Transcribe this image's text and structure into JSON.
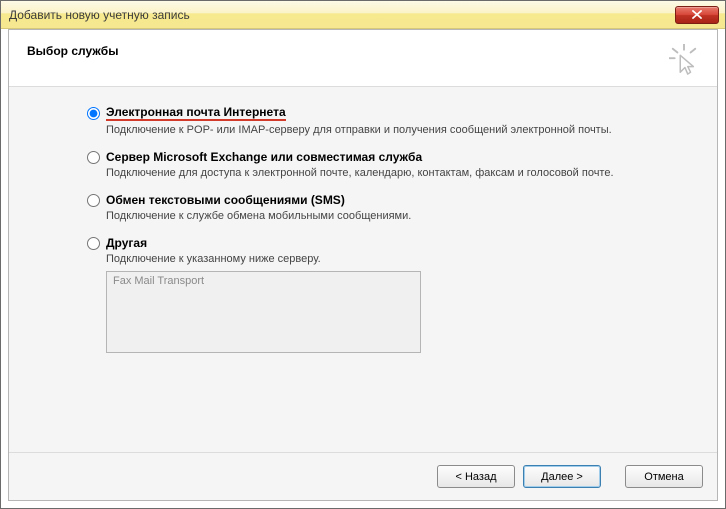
{
  "window": {
    "title": "Добавить новую учетную запись"
  },
  "header": {
    "title": "Выбор службы"
  },
  "options": {
    "internet_mail": {
      "label": "Электронная почта Интернета",
      "desc": "Подключение к POP- или IMAP-серверу для отправки и получения сообщений электронной почты."
    },
    "exchange": {
      "label": "Сервер Microsoft Exchange или совместимая служба",
      "desc": "Подключение для доступа к электронной почте, календарю, контактам, факсам и голосовой почте."
    },
    "sms": {
      "label": "Обмен текстовыми сообщениями (SMS)",
      "desc": "Подключение к службе обмена мобильными сообщениями."
    },
    "other": {
      "label": "Другая",
      "desc": "Подключение к указанному ниже серверу."
    },
    "other_list_item": "Fax Mail Transport"
  },
  "buttons": {
    "back": "< Назад",
    "next": "Далее >",
    "cancel": "Отмена"
  }
}
